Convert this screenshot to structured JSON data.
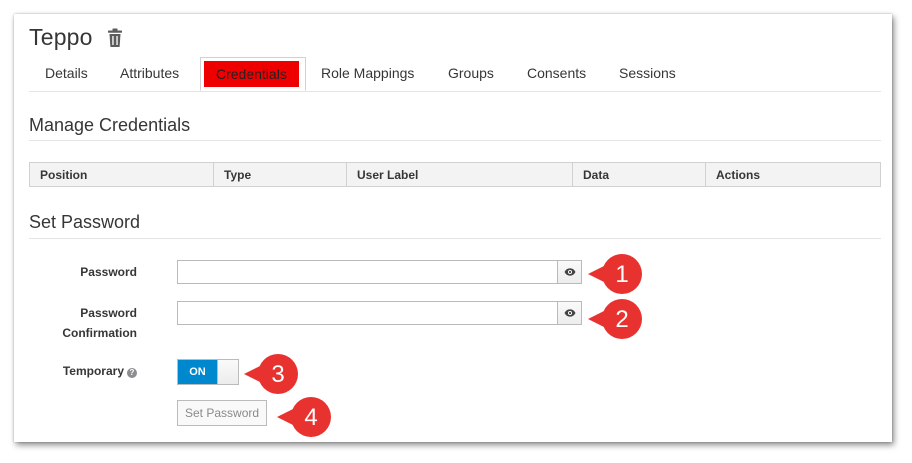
{
  "header": {
    "title": "Teppo",
    "delete_icon": "trash-icon"
  },
  "tabs": [
    {
      "label": "Details",
      "active": false
    },
    {
      "label": "Attributes",
      "active": false
    },
    {
      "label": "Credentials",
      "active": true
    },
    {
      "label": "Role Mappings",
      "active": false
    },
    {
      "label": "Groups",
      "active": false
    },
    {
      "label": "Consents",
      "active": false
    },
    {
      "label": "Sessions",
      "active": false
    }
  ],
  "manage_credentials": {
    "title": "Manage Credentials",
    "columns": [
      "Position",
      "Type",
      "User Label",
      "Data",
      "Actions"
    ]
  },
  "set_password": {
    "title": "Set Password",
    "password_label": "Password",
    "password_value": "",
    "confirm_label_line1": "Password",
    "confirm_label_line2": "Confirmation",
    "confirm_value": "",
    "reveal_icon": "eye-icon",
    "temporary_label": "Temporary",
    "help_icon": "question-circle-icon",
    "temporary_toggle": "ON",
    "submit_label": "Set Password"
  },
  "callouts": [
    "1",
    "2",
    "3",
    "4"
  ],
  "colors": {
    "active_tab_highlight": "#ee0000",
    "toggle_on": "#0088ce",
    "callout": "#e8322f"
  }
}
